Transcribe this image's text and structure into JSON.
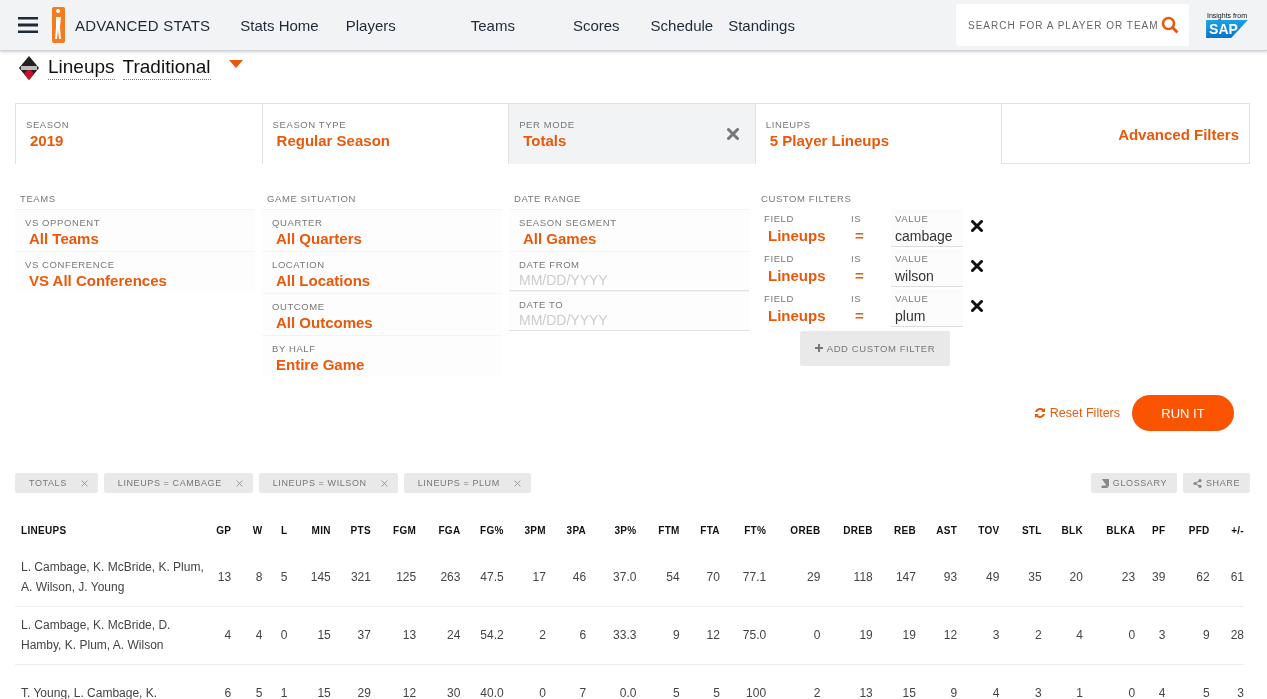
{
  "nav": {
    "brand": "ADVANCED STATS",
    "links": [
      "Stats Home",
      "Players",
      "Teams",
      "Scores",
      "Schedule",
      "Standings"
    ],
    "search": {
      "placeholder": "SEARCH FOR A PLAYER OR TEAM"
    },
    "sponsor": {
      "caption": "Insights from",
      "logo": "SAP"
    }
  },
  "title": {
    "words": [
      "Lineups",
      "Traditional"
    ]
  },
  "main_filters": [
    {
      "label": "SEASON",
      "value": "2019",
      "clearable": false
    },
    {
      "label": "SEASON TYPE",
      "value": "Regular Season",
      "clearable": false
    },
    {
      "label": "PER MODE",
      "value": "Totals",
      "clearable": true
    },
    {
      "label": "LINEUPS",
      "value": "5 Player Lineups",
      "clearable": false
    }
  ],
  "advanced_filters_link": "Advanced Filters",
  "filter_groups": [
    {
      "title": "TEAMS",
      "fields": [
        {
          "kind": "select",
          "label": "VS OPPONENT",
          "value": "All Teams"
        },
        {
          "kind": "select",
          "label": "VS CONFERENCE",
          "value": "VS All Conferences"
        }
      ]
    },
    {
      "title": "GAME SITUATION",
      "fields": [
        {
          "kind": "select",
          "label": "QUARTER",
          "value": "All Quarters"
        },
        {
          "kind": "select",
          "label": "LOCATION",
          "value": "All Locations"
        },
        {
          "kind": "select",
          "label": "OUTCOME",
          "value": "All Outcomes"
        },
        {
          "kind": "select",
          "label": "BY HALF",
          "value": "Entire Game"
        }
      ]
    },
    {
      "title": "DATE RANGE",
      "fields": [
        {
          "kind": "select",
          "label": "SEASON SEGMENT",
          "value": "All Games"
        },
        {
          "kind": "date",
          "label": "DATE FROM",
          "placeholder": "MM/DD/YYYY"
        },
        {
          "kind": "date",
          "label": "DATE TO",
          "placeholder": "MM/DD/YYYY"
        }
      ]
    }
  ],
  "custom_filters": {
    "title": "CUSTOM FILTERS",
    "rows": [
      {
        "field_label": "FIELD",
        "is_label": "IS",
        "value_label": "VALUE",
        "field": "Lineups",
        "op": "=",
        "value": "cambage"
      },
      {
        "field_label": "FIELD",
        "is_label": "IS",
        "value_label": "VALUE",
        "field": "Lineups",
        "op": "=",
        "value": "wilson"
      },
      {
        "field_label": "FIELD",
        "is_label": "IS",
        "value_label": "VALUE",
        "field": "Lineups",
        "op": "=",
        "value": "plum"
      }
    ],
    "add_button": "ADD CUSTOM FILTER"
  },
  "reset_link": "Reset Filters",
  "run_button": "RUN IT",
  "active_tags": [
    "TOTALS",
    "LINEUPS = CAMBAGE",
    "LINEUPS = WILSON",
    "LINEUPS = PLUM"
  ],
  "tools": [
    "GLOSSARY",
    "SHARE"
  ],
  "table": {
    "columns": [
      "LINEUPS",
      "GP",
      "W",
      "L",
      "MIN",
      "PTS",
      "FGM",
      "FGA",
      "FG%",
      "3PM",
      "3PA",
      "3P%",
      "FTM",
      "FTA",
      "FT%",
      "OREB",
      "DREB",
      "REB",
      "AST",
      "TOV",
      "STL",
      "BLK",
      "BLKA",
      "PF",
      "PFD",
      "+/-"
    ],
    "rows": [
      [
        "L. Cambage, K. McBride, K. Plum, A. Wilson, J. Young",
        "13",
        "8",
        "5",
        "145",
        "321",
        "125",
        "263",
        "47.5",
        "17",
        "46",
        "37.0",
        "54",
        "70",
        "77.1",
        "29",
        "118",
        "147",
        "93",
        "49",
        "35",
        "20",
        "23",
        "39",
        "62",
        "61"
      ],
      [
        "L. Cambage, K. McBride, D. Hamby, K. Plum, A. Wilson",
        "4",
        "4",
        "0",
        "15",
        "37",
        "13",
        "24",
        "54.2",
        "2",
        "6",
        "33.3",
        "9",
        "12",
        "75.0",
        "0",
        "19",
        "19",
        "12",
        "3",
        "2",
        "4",
        "0",
        "3",
        "9",
        "28"
      ],
      [
        "T. Young, L. Cambage, K.",
        "6",
        "5",
        "1",
        "15",
        "29",
        "12",
        "30",
        "40.0",
        "0",
        "7",
        "0.0",
        "5",
        "5",
        "100",
        "2",
        "13",
        "15",
        "9",
        "4",
        "3",
        "1",
        "0",
        "4",
        "5",
        "3"
      ]
    ]
  }
}
